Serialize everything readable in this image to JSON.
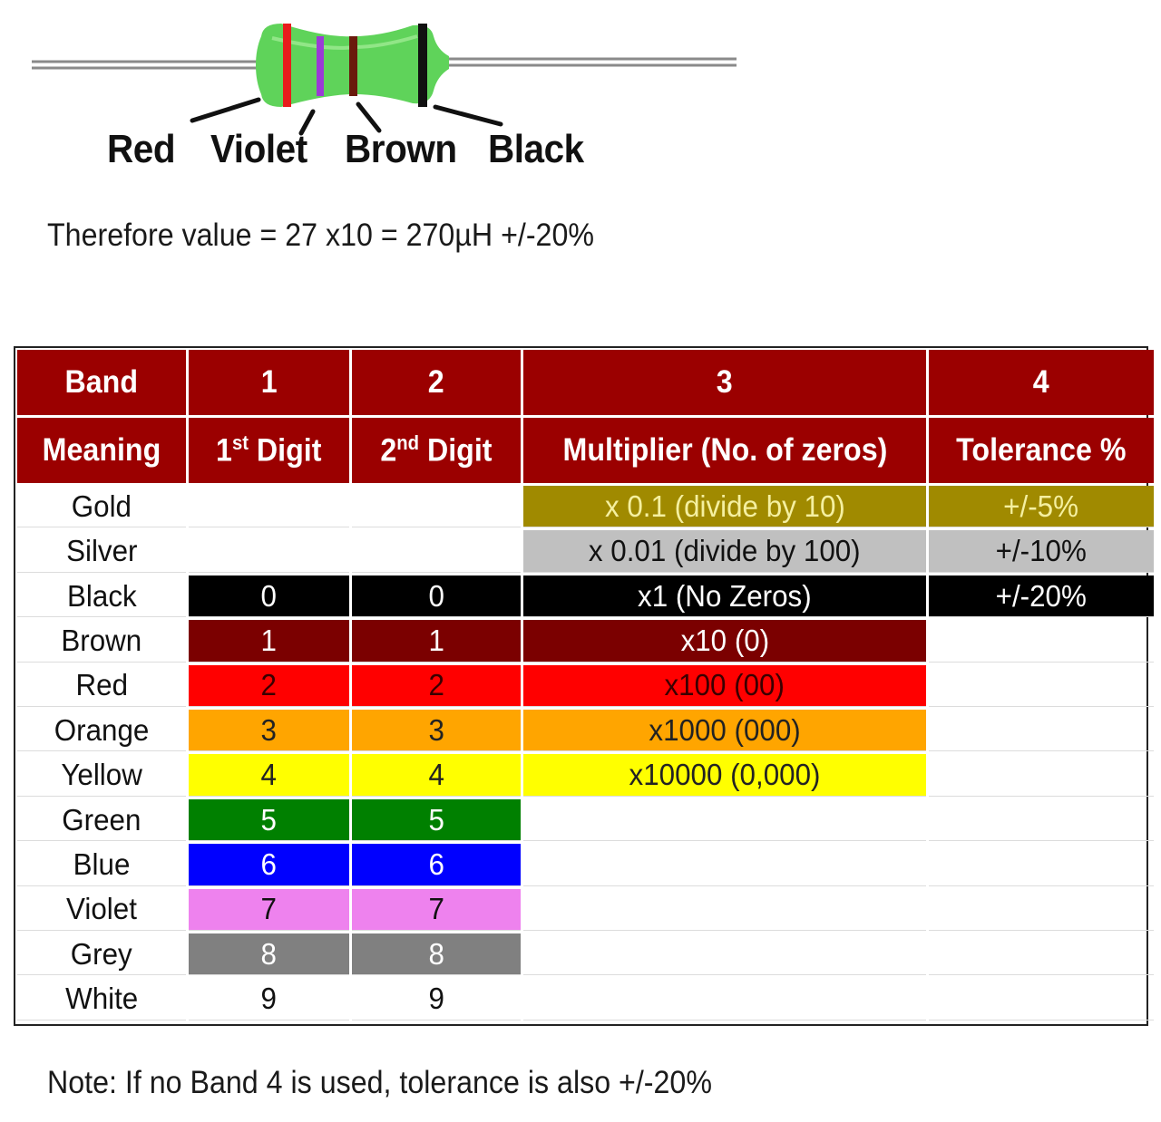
{
  "illustration": {
    "component": "inductor",
    "body_color": "#5fd35a",
    "lead_color": "#9a9a9a",
    "bands": [
      {
        "label": "Red",
        "color": "#e81c1c"
      },
      {
        "label": "Violet",
        "color": "#9b3bd6"
      },
      {
        "label": "Brown",
        "color": "#6a1a0c"
      },
      {
        "label": "Black",
        "color": "#111111"
      }
    ]
  },
  "formula": "Therefore value = 27 x10 = 270µH +/-20%",
  "table": {
    "header_color": "#9b0000",
    "header_row1": [
      "Band",
      "1",
      "2",
      "3",
      "4"
    ],
    "header_row2": {
      "meaning": "Meaning",
      "digit1_num": "1",
      "digit1_sup": "st",
      "digit1_word": " Digit",
      "digit2_num": "2",
      "digit2_sup": "nd",
      "digit2_word": " Digit",
      "multiplier": "Multiplier (No. of zeros)",
      "tolerance": "Tolerance %"
    },
    "rows": [
      {
        "name": "Gold",
        "color": "#a08a00",
        "text_color": "#f5f0a0",
        "digit1": "",
        "digit2": "",
        "multiplier": "x 0.1 (divide by 10)",
        "tolerance": "+/-5%",
        "digit_colored": false,
        "mult_colored": true,
        "tol_colored": true
      },
      {
        "name": "Silver",
        "color": "#c0c0c0",
        "text_color": "#111111",
        "digit1": "",
        "digit2": "",
        "multiplier": "x 0.01 (divide by 100)",
        "tolerance": "+/-10%",
        "digit_colored": false,
        "mult_colored": true,
        "tol_colored": true
      },
      {
        "name": "Black",
        "color": "#000000",
        "text_color": "#ffffff",
        "digit1": "0",
        "digit2": "0",
        "multiplier": "x1 (No Zeros)",
        "tolerance": "+/-20%",
        "digit_colored": true,
        "mult_colored": true,
        "tol_colored": true
      },
      {
        "name": "Brown",
        "color": "#7b0000",
        "text_color": "#ffffff",
        "digit1": "1",
        "digit2": "1",
        "multiplier": "x10 (0)",
        "tolerance": "",
        "digit_colored": true,
        "mult_colored": true,
        "tol_colored": false
      },
      {
        "name": "Red",
        "color": "#ff0000",
        "text_color": "#3a0000",
        "digit1": "2",
        "digit2": "2",
        "multiplier": "x100 (00)",
        "tolerance": "",
        "digit_colored": true,
        "mult_colored": true,
        "tol_colored": false
      },
      {
        "name": "Orange",
        "color": "#ffa500",
        "text_color": "#222222",
        "digit1": "3",
        "digit2": "3",
        "multiplier": "x1000 (000)",
        "tolerance": "",
        "digit_colored": true,
        "mult_colored": true,
        "tol_colored": false
      },
      {
        "name": "Yellow",
        "color": "#ffff00",
        "text_color": "#222222",
        "digit1": "4",
        "digit2": "4",
        "multiplier": "x10000 (0,000)",
        "tolerance": "",
        "digit_colored": true,
        "mult_colored": true,
        "tol_colored": false
      },
      {
        "name": "Green",
        "color": "#008000",
        "text_color": "#ffffff",
        "digit1": "5",
        "digit2": "5",
        "multiplier": "",
        "tolerance": "",
        "digit_colored": true,
        "mult_colored": false,
        "tol_colored": false
      },
      {
        "name": "Blue",
        "color": "#0000ff",
        "text_color": "#ffffff",
        "digit1": "6",
        "digit2": "6",
        "multiplier": "",
        "tolerance": "",
        "digit_colored": true,
        "mult_colored": false,
        "tol_colored": false
      },
      {
        "name": "Violet",
        "color": "#ee82ee",
        "text_color": "#111111",
        "digit1": "7",
        "digit2": "7",
        "multiplier": "",
        "tolerance": "",
        "digit_colored": true,
        "mult_colored": false,
        "tol_colored": false
      },
      {
        "name": "Grey",
        "color": "#808080",
        "text_color": "#ffffff",
        "digit1": "8",
        "digit2": "8",
        "multiplier": "",
        "tolerance": "",
        "digit_colored": true,
        "mult_colored": false,
        "tol_colored": false
      },
      {
        "name": "White",
        "color": "#ffffff",
        "text_color": "#111111",
        "digit1": "9",
        "digit2": "9",
        "multiplier": "",
        "tolerance": "",
        "digit_colored": true,
        "mult_colored": false,
        "tol_colored": false
      }
    ]
  },
  "note": "Note: If no Band 4 is used, tolerance is also +/-20%"
}
